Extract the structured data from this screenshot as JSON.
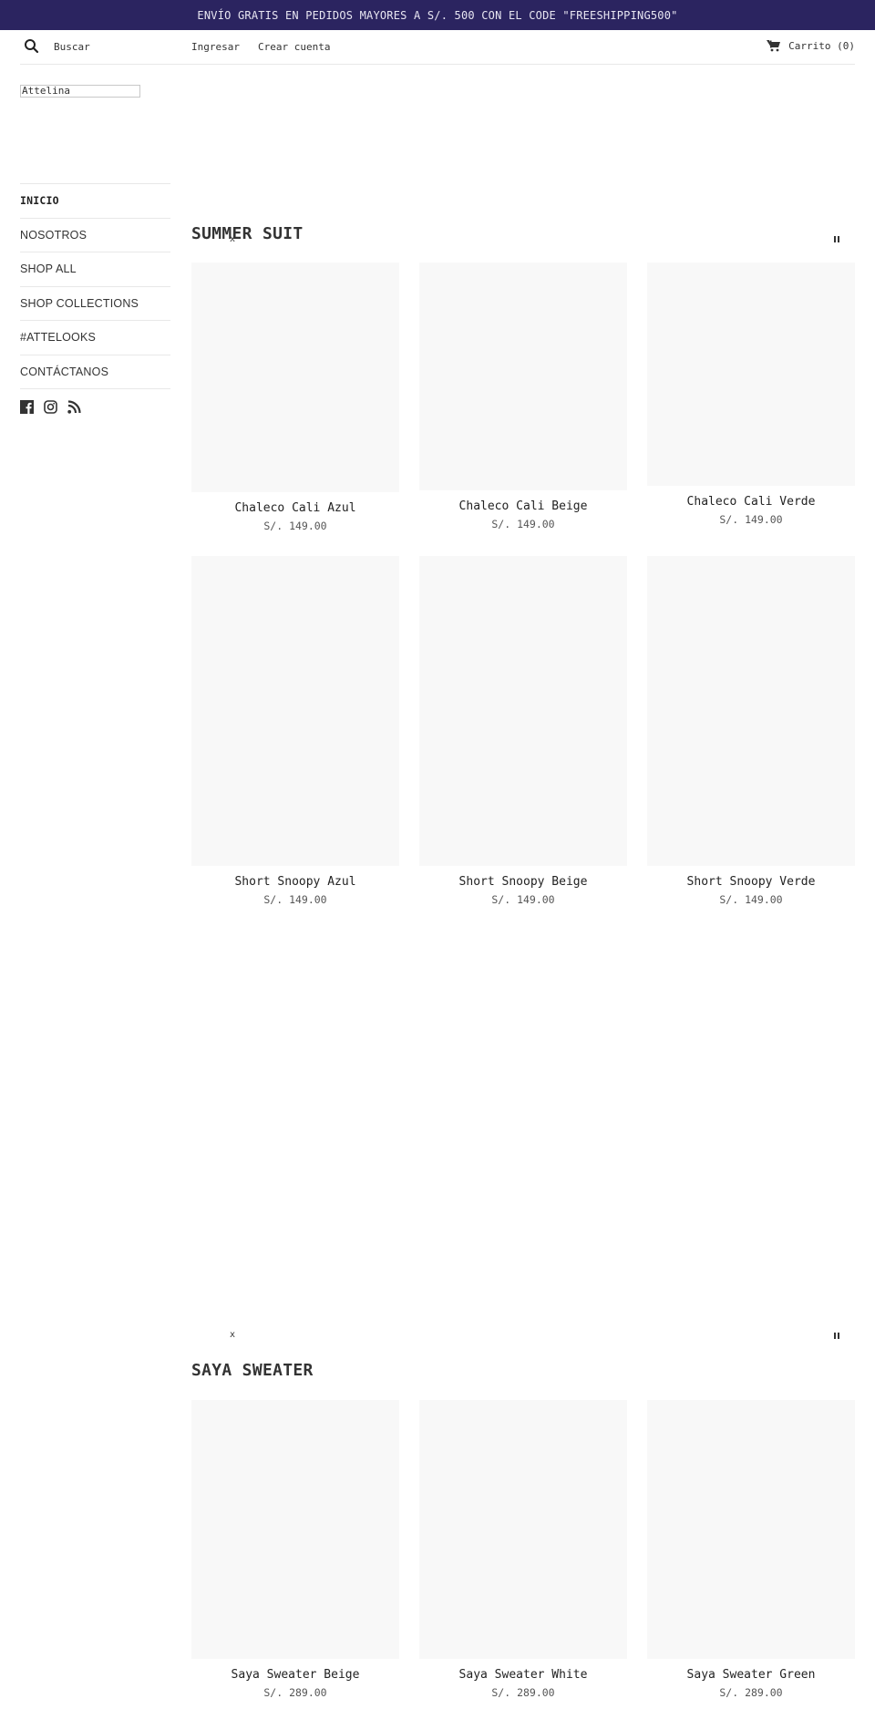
{
  "announcement": "ENVÍO GRATIS EN PEDIDOS MAYORES A S/. 500 CON EL CODE \"FREESHIPPING500\"",
  "header": {
    "search_label": "Buscar",
    "login_label": "Ingresar",
    "register_label": "Crear cuenta",
    "cart_label": "Carrito (0)"
  },
  "logo_alt": "Attelina",
  "sidebar": {
    "items": [
      {
        "label": "INICIO",
        "active": true
      },
      {
        "label": "NOSOTROS"
      },
      {
        "label": "SHOP ALL"
      },
      {
        "label": "SHOP COLLECTIONS"
      },
      {
        "label": "#ATTELOOKS"
      },
      {
        "label": "CONTÁCTANOS"
      }
    ],
    "social": [
      "facebook-icon",
      "instagram-icon",
      "rss-icon"
    ]
  },
  "sections": [
    {
      "title": "SUMMER SUIT",
      "products": [
        {
          "title": "Chaleco Cali Azul",
          "price": "S/. 149.00"
        },
        {
          "title": "Chaleco Cali Beige",
          "price": "S/. 149.00"
        },
        {
          "title": "Chaleco Cali Verde",
          "price": "S/. 149.00"
        },
        {
          "title": "Short Snoopy Azul",
          "price": "S/. 149.00"
        },
        {
          "title": "Short Snoopy Beige",
          "price": "S/. 149.00"
        },
        {
          "title": "Short Snoopy Verde",
          "price": "S/. 149.00"
        }
      ]
    },
    {
      "title": "SAYA SWEATER",
      "products": [
        {
          "title": "Saya Sweater Beige",
          "price": "S/. 289.00"
        },
        {
          "title": "Saya Sweater White",
          "price": "S/. 289.00"
        },
        {
          "title": "Saya Sweater Green",
          "price": "S/. 289.00"
        }
      ]
    }
  ],
  "slideshow": {
    "close_glyph": "x"
  }
}
